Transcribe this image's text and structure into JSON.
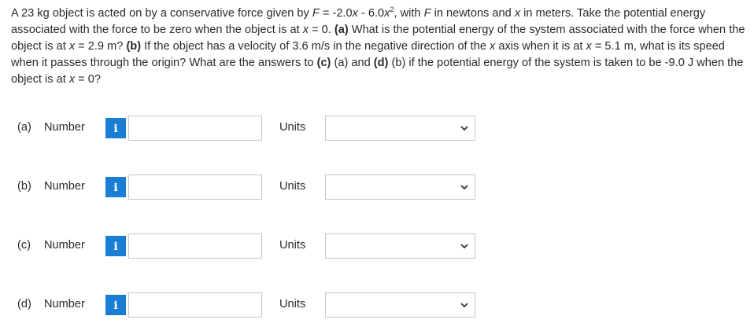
{
  "question": {
    "t1": "A 23 kg object is acted on by a conservative force given by ",
    "f_var": "F",
    "t2": " = -2.0",
    "x1": "x",
    "t3": " - 6.0",
    "x2": "x",
    "exp": "2",
    "t4": ", with ",
    "f_var2": "F",
    "t5": " in newtons and ",
    "x3": "x",
    "t6": " in meters. Take the potential energy associated with the force to be zero when the object is at ",
    "x4": "x",
    "t7": " = 0. ",
    "a_tag": "(a)",
    "t8": " What is the potential energy of the system associated with the force when the object is at ",
    "x5": "x",
    "t9": " = 2.9 m? ",
    "b_tag": "(b)",
    "t10": " If the object has a velocity of 3.6 m/s in the negative direction of the ",
    "x6": "x",
    "t11": " axis when it is at ",
    "x7": "x",
    "t12": " = 5.1 m, what is its speed when it passes through the origin? What are the answers to ",
    "c_tag": "(c)",
    "t13": " (a) and ",
    "d_tag": "(d)",
    "t14": " (b) if the potential energy of the system is taken to be -9.0 J when the object is at ",
    "x8": "x",
    "t15": " = 0?"
  },
  "parts": [
    {
      "letter": "(a)",
      "number_label": "Number",
      "info_glyph": "i",
      "number_value": "",
      "units_label": "Units",
      "units_value": ""
    },
    {
      "letter": "(b)",
      "number_label": "Number",
      "info_glyph": "i",
      "number_value": "",
      "units_label": "Units",
      "units_value": ""
    },
    {
      "letter": "(c)",
      "number_label": "Number",
      "info_glyph": "i",
      "number_value": "",
      "units_label": "Units",
      "units_value": ""
    },
    {
      "letter": "(d)",
      "number_label": "Number",
      "info_glyph": "i",
      "number_value": "",
      "units_label": "Units",
      "units_value": ""
    }
  ],
  "icons": {
    "info": "info-icon",
    "dropdown": "chevron-down-icon"
  },
  "colors": {
    "info_button": "#1a7fd4",
    "text": "#2b2b2b",
    "border": "#c6c6c6"
  }
}
